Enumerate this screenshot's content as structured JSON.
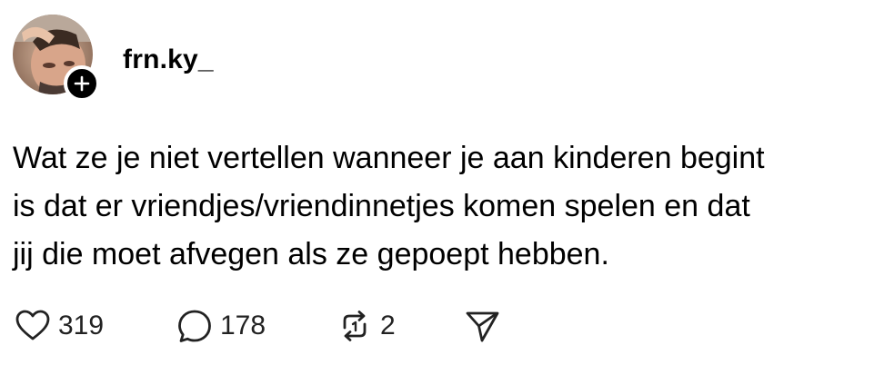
{
  "author": {
    "username": "frn.ky_",
    "avatar_icon": "profile-photo",
    "follow_icon": "plus-icon"
  },
  "post": {
    "text_lines": [
      "Wat ze je niet vertellen wanneer je aan kinderen begint",
      "is dat er vriendjes/vriendinnetjes komen spelen en dat",
      "jij die moet afvegen als ze gepoept hebben."
    ]
  },
  "actions": {
    "like": {
      "icon": "heart-icon",
      "count": "319"
    },
    "comment": {
      "icon": "speech-bubble-icon",
      "count": "178"
    },
    "repost": {
      "icon": "repost-icon",
      "count": "2"
    },
    "share": {
      "icon": "send-icon"
    }
  },
  "colors": {
    "text": "#000000",
    "icon": "#222222",
    "badge": "#000000",
    "background": "#ffffff"
  }
}
